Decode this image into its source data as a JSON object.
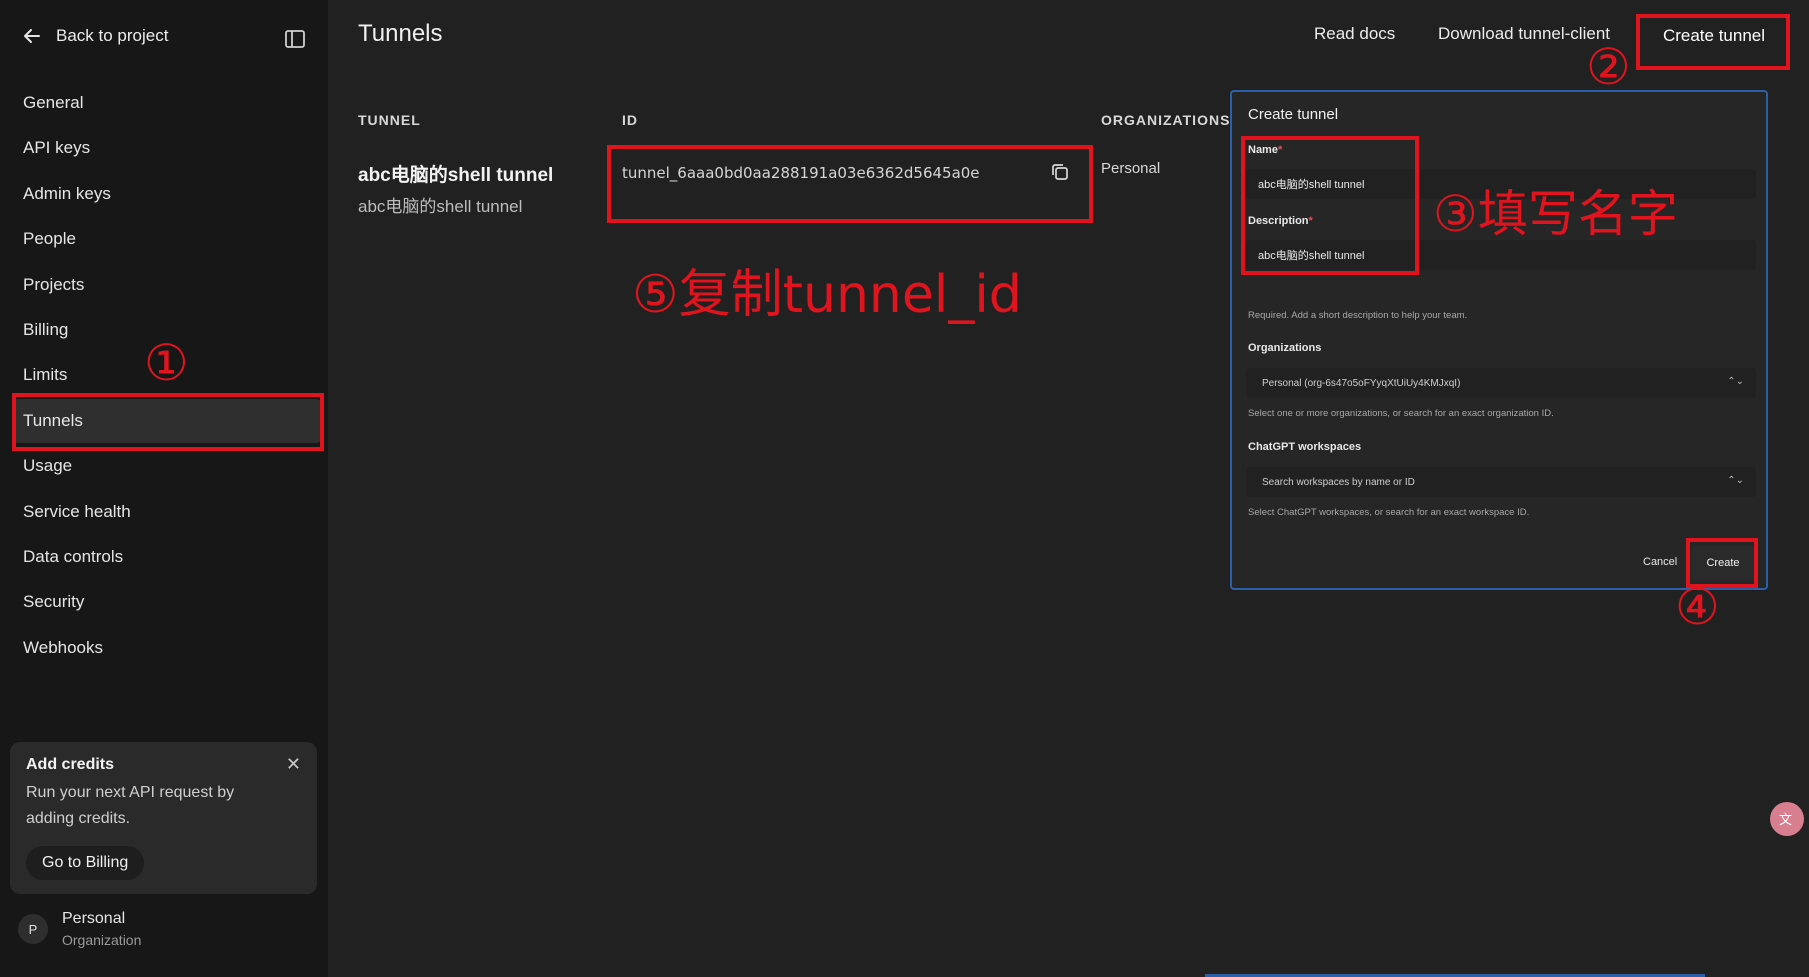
{
  "sidebar": {
    "back_label": "Back to project",
    "items": [
      {
        "label": "General"
      },
      {
        "label": "API keys"
      },
      {
        "label": "Admin keys"
      },
      {
        "label": "People"
      },
      {
        "label": "Projects"
      },
      {
        "label": "Billing"
      },
      {
        "label": "Limits"
      },
      {
        "label": "Tunnels",
        "active": true
      },
      {
        "label": "Usage"
      },
      {
        "label": "Service health"
      },
      {
        "label": "Data controls"
      },
      {
        "label": "Security"
      },
      {
        "label": "Webhooks"
      }
    ],
    "credits_card": {
      "title": "Add credits",
      "text": "Run your next API request by adding credits.",
      "button": "Go to Billing"
    },
    "org": {
      "avatar": "P",
      "name": "Personal",
      "sub": "Organization"
    }
  },
  "header": {
    "title": "Tunnels",
    "read_docs": "Read docs",
    "download_client": "Download tunnel-client",
    "create_tunnel": "Create tunnel"
  },
  "table": {
    "columns": [
      "TUNNEL",
      "ID",
      "ORGANIZATIONS"
    ],
    "rows": [
      {
        "name": "abc电脑的shell tunnel",
        "description": "abc电脑的shell tunnel",
        "id": "tunnel_6aaa0bd0aa288191a03e6362d5645a0e",
        "org": "Personal"
      }
    ]
  },
  "dialog": {
    "title": "Create tunnel",
    "name_label": "Name",
    "name_value": "abc电脑的shell tunnel",
    "desc_label": "Description",
    "desc_value": "abc电脑的shell tunnel",
    "desc_help": "Required. Add a short description to help your team.",
    "org_label": "Organizations",
    "org_value": "Personal (org-6s47o5oFYyqXtUiUy4KMJxqI)",
    "org_help": "Select one or more organizations, or search for an exact organization ID.",
    "workspaces_label": "ChatGPT workspaces",
    "workspaces_placeholder": "Search workspaces by name or ID",
    "workspaces_help": "Select ChatGPT workspaces, or search for an exact workspace ID.",
    "cancel": "Cancel",
    "create": "Create"
  },
  "annotations": {
    "step1": "①",
    "step2": "②",
    "step3": "③填写名字",
    "step4": "④",
    "step5": "⑤复制tunnel_id",
    "color": "#e0141e"
  },
  "colors": {
    "sidebar_bg": "#171717",
    "main_bg": "#212121",
    "dialog_border": "#2d5fa8"
  }
}
